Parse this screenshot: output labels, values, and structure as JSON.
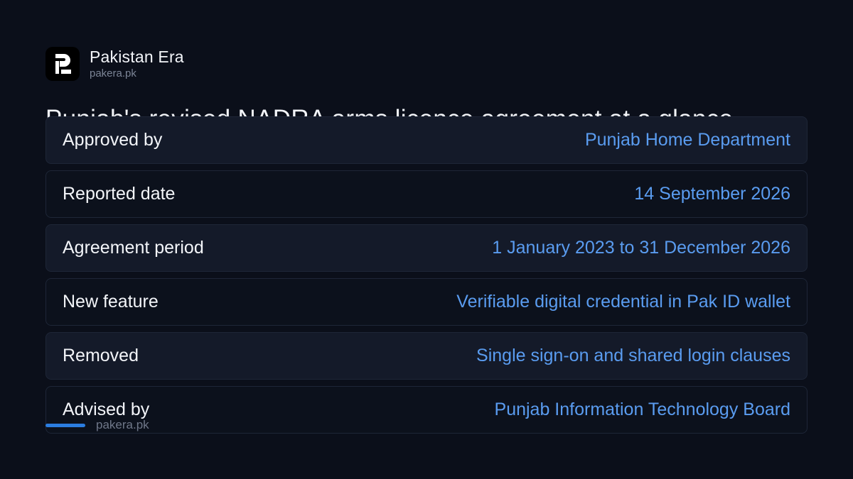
{
  "brand": {
    "name": "Pakistan Era",
    "domain": "pakera.pk",
    "logo_icon": "pakistan-era-logo-icon"
  },
  "headline": "Punjab's revised NADRA arms licence agreement at a glance",
  "rows": [
    {
      "label": "Approved by",
      "value": "Punjab Home Department"
    },
    {
      "label": "Reported date",
      "value": "14 September 2026"
    },
    {
      "label": "Agreement period",
      "value": "1 January 2023 to 31 December 2026"
    },
    {
      "label": "New feature",
      "value": "Verifiable digital credential in Pak ID wallet"
    },
    {
      "label": "Removed",
      "value": "Single sign-on and shared login clauses"
    },
    {
      "label": "Advised by",
      "value": "Punjab Information Technology Board"
    }
  ],
  "footer": {
    "domain": "pakera.pk"
  },
  "colors": {
    "background": "#0b0f1a",
    "value_text": "#5a9cf0",
    "accent": "#2b7de0"
  }
}
